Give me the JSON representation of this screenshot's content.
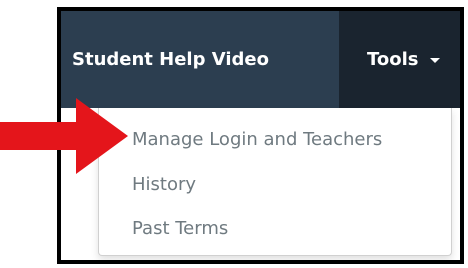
{
  "navbar": {
    "help_link": "Student Help Video",
    "tools_label": "Tools"
  },
  "tools_menu": {
    "items": [
      {
        "label": "Manage Login and Teachers"
      },
      {
        "label": "History"
      },
      {
        "label": "Past Terms"
      }
    ]
  },
  "colors": {
    "navbar_bg": "#2c3e50",
    "tools_bg": "#1a242f",
    "menu_text": "#6f7a80",
    "arrow": "#e4151b"
  },
  "icons": {
    "caret": "caret-down-icon",
    "annotation": "red-arrow-icon"
  }
}
